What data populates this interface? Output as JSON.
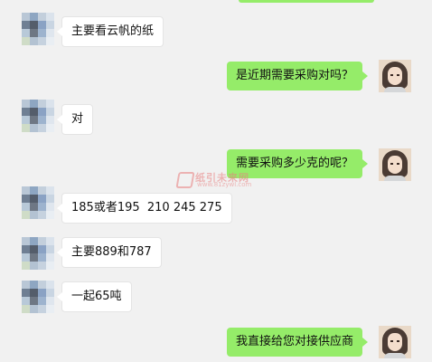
{
  "messages": [
    {
      "side": "left",
      "text": "主要看云帆的纸"
    },
    {
      "side": "right",
      "text": "是近期需要采购对吗？"
    },
    {
      "side": "left",
      "text": "对"
    },
    {
      "side": "right",
      "text": "需要采购多少克的呢？"
    },
    {
      "side": "left",
      "text": "185或者195  210 245 275"
    },
    {
      "side": "left",
      "text": "主要889和787"
    },
    {
      "side": "left",
      "text": "一起65吨"
    },
    {
      "side": "right",
      "text": "我直接给您对接供应商"
    }
  ],
  "watermark": {
    "name": "纸引未来网",
    "url": "www.81zywl.com"
  },
  "colors": {
    "background": "#f1f1f1",
    "outgoing_bubble": "#95ec69",
    "incoming_bubble": "#ffffff"
  }
}
